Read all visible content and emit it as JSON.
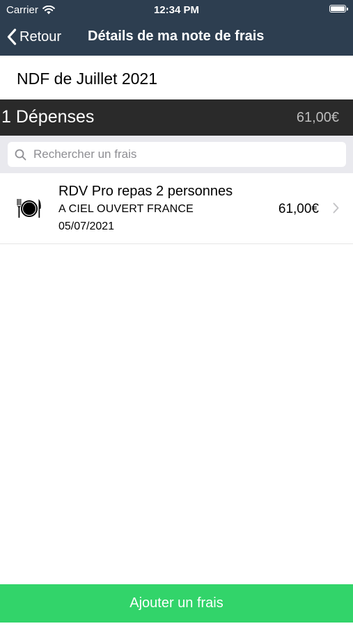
{
  "status_bar": {
    "carrier": "Carrier",
    "time": "12:34 PM",
    "wifi_icon": "wifi-icon",
    "battery_icon": "battery-icon"
  },
  "nav": {
    "back_label": "Retour",
    "title": "Détails de ma note de frais",
    "background_color": "#2d3e50"
  },
  "report": {
    "title": "NDF de Juillet 2021"
  },
  "summary": {
    "count_label": "1 Dépenses",
    "total": "61,00€"
  },
  "search": {
    "placeholder": "Rechercher un frais",
    "value": ""
  },
  "expenses": [
    {
      "icon": "restaurant-icon",
      "label": "RDV Pro repas 2 personnes",
      "merchant": "A CIEL OUVERT FRANCE",
      "date": "05/07/2021",
      "amount": "61,00€"
    }
  ],
  "footer": {
    "add_label": "Ajouter un frais",
    "accent_color": "#32d46a"
  }
}
